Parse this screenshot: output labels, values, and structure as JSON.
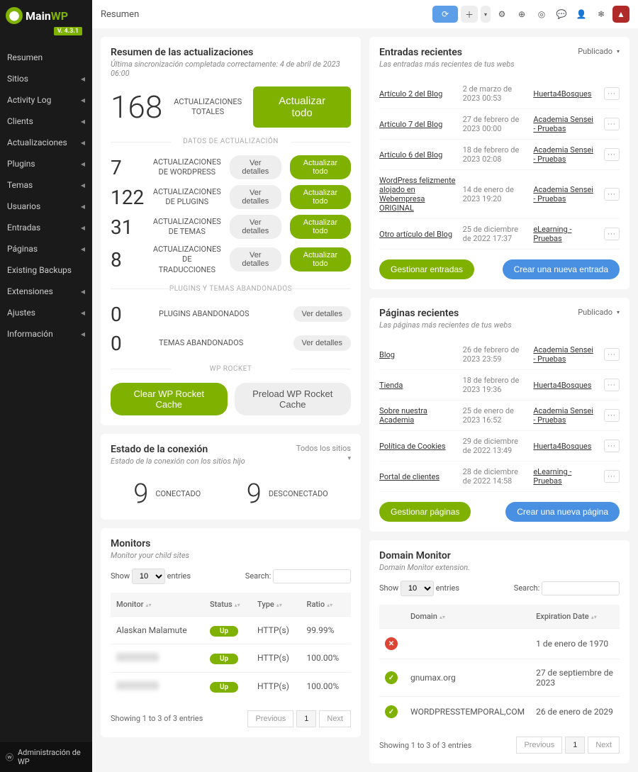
{
  "brand": {
    "name_main": "Main",
    "name_wp": "WP",
    "version": "V. 4.3.1"
  },
  "topbar": {
    "title": "Resumen"
  },
  "nav": {
    "items": [
      {
        "label": "Resumen",
        "caret": false
      },
      {
        "label": "Sitios",
        "caret": true
      },
      {
        "label": "Activity Log",
        "caret": true
      },
      {
        "label": "Clients",
        "caret": true
      },
      {
        "label": "Actualizaciones",
        "caret": true
      },
      {
        "label": "Plugins",
        "caret": true
      },
      {
        "label": "Temas",
        "caret": true
      },
      {
        "label": "Usuarios",
        "caret": true
      },
      {
        "label": "Entradas",
        "caret": true
      },
      {
        "label": "Páginas",
        "caret": true
      },
      {
        "label": "Existing Backups",
        "caret": false
      },
      {
        "label": "Extensiones",
        "caret": true
      },
      {
        "label": "Ajustes",
        "caret": true
      },
      {
        "label": "Información",
        "caret": true
      }
    ]
  },
  "sidebar_footer": {
    "label": "Administración de WP"
  },
  "updates": {
    "title": "Resumen de las actualizaciones",
    "sub": "Última sincronización completada correctamente: 4 de abril de 2023 06:00",
    "total_num": "168",
    "total_label": "ACTUALIZACIONES TOTALES",
    "update_all": "Actualizar todo",
    "divider1": "DATOS DE ACTUALIZACIÓN",
    "rows": [
      {
        "num": "7",
        "label": "ACTUALIZACIONES DE WORDPRESS"
      },
      {
        "num": "122",
        "label": "ACTUALIZACIONES DE PLUGINS"
      },
      {
        "num": "31",
        "label": "ACTUALIZACIONES DE TEMAS"
      },
      {
        "num": "8",
        "label": "ACTUALIZACIONES DE TRADUCCIONES"
      }
    ],
    "view_details": "Ver detalles",
    "update_row": "Actualizar todo",
    "divider2": "PLUGINS Y TEMAS ABANDONADOS",
    "abandoned": [
      {
        "num": "0",
        "label": "PLUGINS ABANDONADOS"
      },
      {
        "num": "0",
        "label": "TEMAS ABANDONADOS"
      }
    ],
    "divider3": "WP ROCKET",
    "clear_cache": "Clear WP Rocket Cache",
    "preload_cache": "Preload WP Rocket Cache"
  },
  "connection": {
    "title": "Estado de la conexión",
    "sub": "Estado de la conexión con los sitios hijo",
    "all_sites": "Todos los sitios",
    "connected_num": "9",
    "connected_label": "CONECTADO",
    "disconnected_num": "9",
    "disconnected_label": "DESCONECTADO"
  },
  "monitors": {
    "title": "Monitors",
    "sub": "Monitor your child sites",
    "show": "Show",
    "show_num": "10",
    "entries": "entries",
    "search": "Search:",
    "headers": {
      "monitor": "Monitor",
      "status": "Status",
      "type": "Type",
      "ratio": "Ratio"
    },
    "rows": [
      {
        "name": "Alaskan Malamute",
        "status": "Up",
        "type": "HTTP(s)",
        "ratio": "99.99%"
      },
      {
        "name": "",
        "status": "Up",
        "type": "HTTP(s)",
        "ratio": "100.00%"
      },
      {
        "name": "",
        "status": "Up",
        "type": "HTTP(s)",
        "ratio": "100.00%"
      }
    ],
    "pager_info": "Showing 1 to 3 of 3 entries",
    "prev": "Previous",
    "page": "1",
    "next": "Next"
  },
  "recent_posts": {
    "title": "Entradas recientes",
    "sub": "Las entradas más recientes de tus webs",
    "pub": "Publicado",
    "rows": [
      {
        "title": "Artículo 2 del Blog",
        "date": "2 de marzo de 2023 00:53",
        "site": "Huerta4Bosques"
      },
      {
        "title": "Artículo 7 del Blog",
        "date": "27 de febrero de 2023 00:00",
        "site": "Academia Sensei - Pruebas"
      },
      {
        "title": "Artículo 6 del Blog",
        "date": "18 de febrero de 2023 02:08",
        "site": "Academia Sensei - Pruebas"
      },
      {
        "title": "WordPress felizmente alojado en Webempresa ORIGINAL",
        "date": "14 de enero de 2023 19:20",
        "site": "Academia Sensei - Pruebas"
      },
      {
        "title": "Otro artículo del Blog",
        "date": "25 de diciembre de 2022 17:37",
        "site": "eLearning - Pruebas"
      }
    ],
    "manage": "Gestionar entradas",
    "create": "Crear una nueva entrada"
  },
  "recent_pages": {
    "title": "Páginas recientes",
    "sub": "Las páginas más recientes de tus webs",
    "pub": "Publicado",
    "rows": [
      {
        "title": "Blog",
        "date": "26 de febrero de 2023 23:59",
        "site": "Academia Sensei - Pruebas"
      },
      {
        "title": "Tienda",
        "date": "18 de febrero de 2023 19:36",
        "site": "Huerta4Bosques"
      },
      {
        "title": "Sobre nuestra Academia",
        "date": "25 de enero de 2023 16:52",
        "site": "Academia Sensei - Pruebas"
      },
      {
        "title": "Política de Cookies",
        "date": "29 de diciembre de 2022 13:49",
        "site": "Huerta4Bosques"
      },
      {
        "title": "Portal de clientes",
        "date": "28 de diciembre de 2022 14:58",
        "site": "eLearning - Pruebas"
      }
    ],
    "manage": "Gestionar páginas",
    "create": "Crear una nueva página"
  },
  "domain_monitor": {
    "title": "Domain Monitor",
    "sub": "Domain Monitor extension.",
    "show": "Show",
    "show_num": "10",
    "entries": "entries",
    "search": "Search:",
    "headers": {
      "domain": "Domain",
      "expiration": "Expiration Date"
    },
    "rows": [
      {
        "status": "err",
        "name": "",
        "exp": "1 de enero de 1970"
      },
      {
        "status": "ok",
        "name": "gnumax.org",
        "exp": "27 de septiembre de 2023"
      },
      {
        "status": "ok",
        "name": "WORDPRESSTEMPORAL,COM",
        "exp": "26 de enero de 2029"
      }
    ],
    "pager_info": "Showing 1 to 3 of 3 entries",
    "prev": "Previous",
    "page": "1",
    "next": "Next"
  }
}
